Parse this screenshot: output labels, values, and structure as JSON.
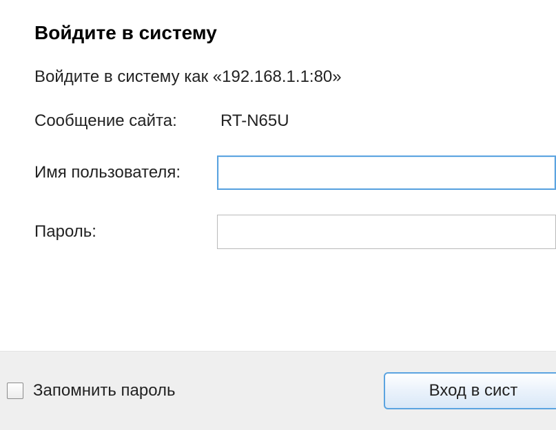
{
  "dialog": {
    "heading": "Войдите в систему",
    "subheading": "Войдите в систему как «192.168.1.1:80»",
    "site_message_label": "Сообщение сайта:",
    "site_message_value": "RT-N65U",
    "username_label": "Имя пользователя:",
    "username_value": "",
    "password_label": "Пароль:",
    "password_value": ""
  },
  "footer": {
    "remember_label": "Запомнить пароль",
    "remember_checked": false,
    "login_button_label": "Вход в сист"
  }
}
